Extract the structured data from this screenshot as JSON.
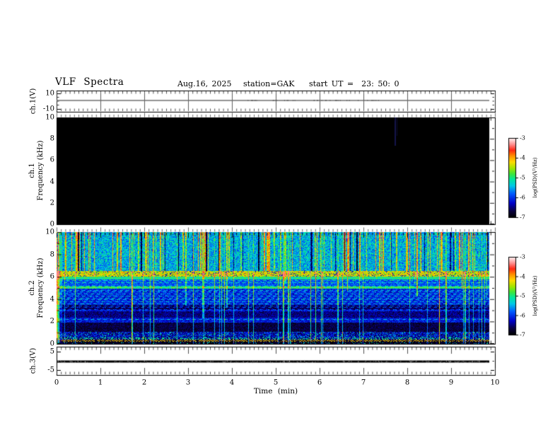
{
  "header": {
    "title": "VLF Spectra",
    "date": "Aug.16, 2025",
    "station": "station=GAK",
    "start_ut": "start UT =  23: 50: 0"
  },
  "xaxis": {
    "label": "Time (min)",
    "ticks": [
      "0",
      "1",
      "2",
      "3",
      "4",
      "5",
      "6",
      "7",
      "8",
      "9",
      "10"
    ]
  },
  "panels": {
    "ch1v": {
      "label": "ch.1(V)",
      "yticks": [
        "10",
        "-10"
      ]
    },
    "ch1spec": {
      "label_line1": "ch.1",
      "label_line2": "Frequency (kHz)",
      "yticks": [
        "0",
        "2",
        "4",
        "6",
        "8",
        "10"
      ]
    },
    "ch2spec": {
      "label_line1": "ch.2",
      "label_line2": "Frequency (kHz)",
      "yticks": [
        "0",
        "2",
        "4",
        "6",
        "8",
        "10"
      ]
    },
    "ch3v": {
      "label": "ch.3(V)",
      "yticks": [
        "5",
        "-5"
      ]
    }
  },
  "colorbars": [
    {
      "label": "log(PSD)(V²/Hz)",
      "ticks": [
        "-3",
        "-4",
        "-5",
        "-6",
        "-7"
      ]
    },
    {
      "label": "log(PSD)(V²/Hz)",
      "ticks": [
        "-3",
        "-4",
        "-5",
        "-6",
        "-7"
      ]
    }
  ],
  "chart_data": {
    "type": "heatmap",
    "title": "VLF Spectra",
    "date": "Aug.16, 2025",
    "station": "GAK",
    "start_ut": "23:50:0",
    "x": {
      "label": "Time (min)",
      "range": [
        0,
        10
      ],
      "data_end_min": 9.87,
      "major_tick": 1,
      "minor_tick": 0.1
    },
    "panels": [
      {
        "id": "ch1_waveform",
        "ylabel": "ch.1(V)",
        "yrange": [
          -13.6,
          13.6
        ],
        "yticks": [
          10,
          -10
        ],
        "signal": "flat gray trace at 0 V for full record",
        "line_color": "#6e6e6e"
      },
      {
        "id": "ch1_spectrogram",
        "ylabel": "ch.1 Frequency (kHz)",
        "yrange": [
          0,
          10
        ],
        "yticks": [
          0,
          2,
          4,
          6,
          8,
          10
        ],
        "content": "no detectable power: uniformly at/below -7 log(PSD) (black); single faint dark-blue vertical streak near 7.7 min above ~7.4 kHz"
      },
      {
        "id": "ch2_spectrogram",
        "ylabel": "ch.2 Frequency (kHz)",
        "yrange": [
          0,
          10
        ],
        "yticks": [
          0,
          2,
          4,
          6,
          8,
          10
        ],
        "content": "broadband VLF activity",
        "features": [
          "cyan background 6.6-10 kHz crossed by dense bright green/yellow vertical sferic streaks with orange tips at 10 kHz",
          "intense yellow band ~6.0-6.55 kHz (log PSD ~ -4.3) with dark specks",
          "green band near 5.0-5.15 kHz",
          "blue region 2.9-5 kHz with dashed cyan horizontal lines and navy patches",
          "very dark navy/black bands 1.0-2.9 kHz",
          "speckled multicolor rows below 1 kHz with dark-red dashed line near 0.3 kHz",
          "thin cyan/green vertical lines crossing full bandwidth"
        ]
      },
      {
        "id": "ch3_waveform",
        "ylabel": "ch.3(V)",
        "yrange": [
          -7.7,
          7.7
        ],
        "yticks": [
          5,
          -5
        ],
        "signal": "flat thick black trace at 0 V for full record",
        "line_color": "#000000"
      }
    ],
    "colorbar": {
      "label": "log(PSD)(V²/Hz)",
      "range": [
        -7,
        -3
      ],
      "ticks": [
        -3,
        -4,
        -5,
        -6,
        -7
      ]
    },
    "colormap_stops": [
      [
        0.0,
        "#000000"
      ],
      [
        0.08,
        "#0a003c"
      ],
      [
        0.18,
        "#0000c8"
      ],
      [
        0.3,
        "#005aff"
      ],
      [
        0.4,
        "#00c8e6"
      ],
      [
        0.48,
        "#00e6a0"
      ],
      [
        0.55,
        "#3ce63c"
      ],
      [
        0.62,
        "#a0e600"
      ],
      [
        0.7,
        "#ffdc00"
      ],
      [
        0.78,
        "#ff8c00"
      ],
      [
        0.85,
        "#ff2814"
      ],
      [
        0.92,
        "#ff8c8c"
      ],
      [
        1.0,
        "#fff5f5"
      ]
    ],
    "render_params": {
      "seed": 42,
      "value_range": [
        -7,
        -3.35
      ],
      "bands": [
        {
          "f": [
            6.55,
            10.01
          ],
          "base": -5.45,
          "noise": 0.55
        },
        {
          "f": [
            6.0,
            6.55
          ],
          "base": -4.35,
          "noise": 0.5,
          "dark_speck": 0.12
        },
        {
          "f": [
            5.75,
            6.0
          ],
          "base": -5.05,
          "noise": 0.4
        },
        {
          "f": [
            5.15,
            5.75
          ],
          "base": -5.85,
          "noise": 0.35,
          "dash": 1
        },
        {
          "f": [
            4.95,
            5.15
          ],
          "base": -4.95,
          "noise": 0.45
        },
        {
          "f": [
            2.9,
            4.95
          ],
          "base": -6.1,
          "noise": 0.35,
          "dash": 1,
          "navy": [
            3.05,
            3.5
          ]
        },
        {
          "f": [
            2.35,
            2.9
          ],
          "base": -6.5,
          "noise": 0.3
        },
        {
          "f": [
            1.9,
            2.35
          ],
          "base": -6.15,
          "noise": 0.35,
          "dash": 1
        },
        {
          "f": [
            1.05,
            1.9
          ],
          "base": -6.7,
          "noise": 0.25
        },
        {
          "f": [
            0.55,
            1.05
          ],
          "base": -6.3,
          "noise": 0.5,
          "bright_speck": 0.1
        },
        {
          "f": [
            0.35,
            0.55
          ],
          "base": -6.4,
          "noise": 0.3,
          "green_speck": 0.35
        },
        {
          "f": [
            0.2,
            0.35
          ],
          "base": -6.7,
          "noise": 0.2,
          "red_dash": 0.6
        },
        {
          "f": [
            0.0,
            0.2
          ],
          "base": -6.8,
          "noise": 0.3,
          "bright_speck": 0.08
        }
      ],
      "streaks": {
        "bright": 95,
        "dark": 28,
        "full": 48
      }
    }
  }
}
